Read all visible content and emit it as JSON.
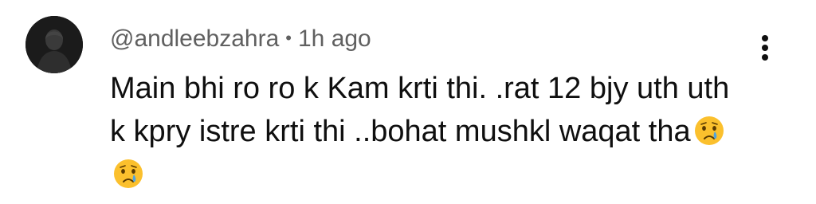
{
  "comment": {
    "author": "@andleebzahra",
    "separator": "•",
    "timestamp": "1h ago",
    "text": "Main bhi ro ro k Kam krti thi. .rat 12 bjy uth uth k kpry istre krti thi ..bohat mushkl waqat tha",
    "emojis": [
      "crying-face-emoji",
      "crying-face-emoji"
    ]
  },
  "icons": {
    "menu": "more-vertical-icon"
  },
  "colors": {
    "meta_text": "#606060",
    "body_text": "#0f0f0f",
    "emoji_face": "#fbc02d",
    "tear": "#4fa3e0"
  }
}
